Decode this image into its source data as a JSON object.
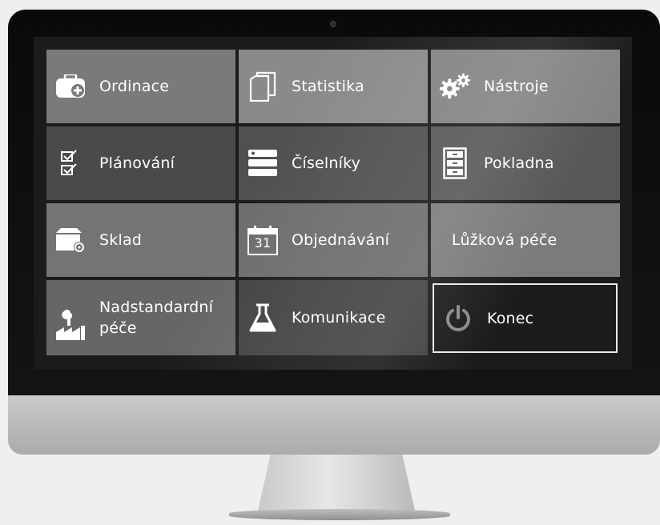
{
  "tiles": [
    {
      "label": "Ordinace",
      "icon": "medical-case-icon"
    },
    {
      "label": "Statistika",
      "icon": "documents-icon"
    },
    {
      "label": "Nástroje",
      "icon": "gears-icon"
    },
    {
      "label": "Plánování",
      "icon": "checklist-icon"
    },
    {
      "label": "Číselníky",
      "icon": "server-list-icon"
    },
    {
      "label": "Pokladna",
      "icon": "cabinet-icon"
    },
    {
      "label": "Sklad",
      "icon": "warehouse-box-icon"
    },
    {
      "label": "Objednávání",
      "icon": "calendar-icon",
      "calendar_day": "31"
    },
    {
      "label": "Lůžková péče",
      "icon": ""
    },
    {
      "label": "Nadstandardní péče",
      "icon": "factory-icon"
    },
    {
      "label": "Komunikace",
      "icon": "flask-icon"
    },
    {
      "label": "Konec",
      "icon": "power-icon"
    }
  ],
  "colors": {
    "tile_text": "#ffffff",
    "screen_background": "#1b1b1b",
    "konec_border": "#e9e9e9"
  }
}
